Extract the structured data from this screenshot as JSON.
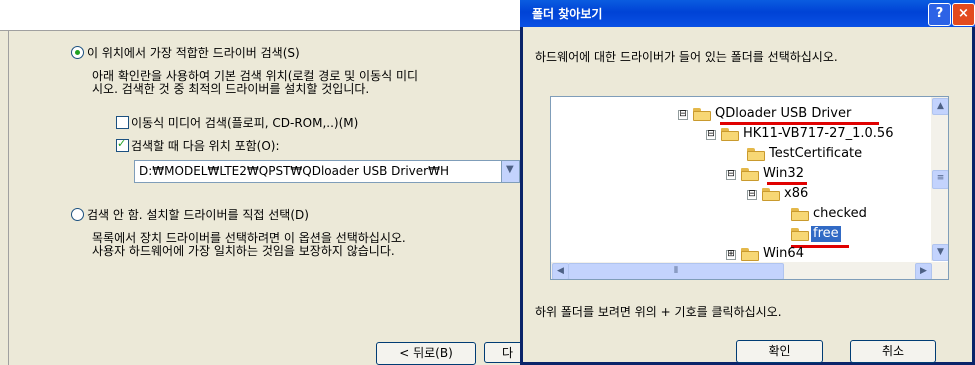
{
  "wizard": {
    "option_search_label": "이 위치에서 가장 적합한 드라이버 검색(S)",
    "option_search_desc_1": "아래 확인란을 사용하여 기본 검색 위치(로컬 경로 및 이동식 미디",
    "option_search_desc_2": "시오. 검색한 것 중 최적의 드라이버를 설치할 것입니다.",
    "removable_media_label": "이동식 미디어 검색(플로피, CD-ROM,..)(M)",
    "include_location_label": "검색할 때 다음 위치 포함(O):",
    "path_value": "D:₩MODEL₩LTE2₩QPST₩QDloader USB Driver₩H",
    "option_manual_label": "검색 안 함. 설치할 드라이버를 직접 선택(D)",
    "option_manual_desc_1": "목록에서 장치 드라이버를 선택하려면 이 옵션을 선택하십시오.",
    "option_manual_desc_2": "사용자 하드웨어에 가장 일치하는 것임을 보장하지 않습니다.",
    "back_button": "< 뒤로(B)",
    "next_button": "다"
  },
  "dialog": {
    "title": "폴더 찾아보기",
    "help_button": "?",
    "close_button": "×",
    "instruction": "하드웨어에 대한 드라이버가 들어 있는 폴더를 선택하십시오.",
    "hint": "하위 폴더를 보려면 위의 + 기호를 클릭하십시오.",
    "ok_button": "확인",
    "cancel_button": "취소",
    "tree": [
      {
        "label": "QDloader USB Driver",
        "expander": "⊟"
      },
      {
        "label": "HK11-VB717-27_1.0.56",
        "expander": "⊟"
      },
      {
        "label": "TestCertificate",
        "expander": ""
      },
      {
        "label": "Win32",
        "expander": "⊟"
      },
      {
        "label": "x86",
        "expander": "⊟"
      },
      {
        "label": "checked",
        "expander": ""
      },
      {
        "label": "free",
        "expander": "",
        "selected": true
      },
      {
        "label": "Win64",
        "expander": "⊞"
      }
    ]
  }
}
